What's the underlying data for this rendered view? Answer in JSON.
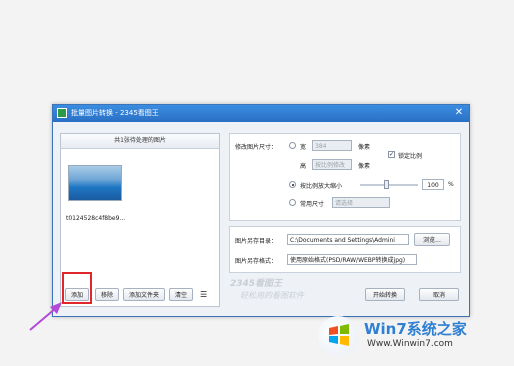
{
  "window": {
    "title": "批量图片转换 - 2345看图王",
    "close": "✕"
  },
  "left_panel": {
    "header": "共1张待处理的图片",
    "thumb_label": "t0124528c4f8be9..."
  },
  "bottom_buttons": {
    "add": "添加",
    "remove": "移除",
    "add_folder": "添加文件夹",
    "clear": "清空",
    "list_icon": "☰"
  },
  "resize": {
    "label": "修改图片尺寸：",
    "width_label": "宽",
    "width_value": "384",
    "width_unit": "像素",
    "height_label": "高",
    "height_value": "按比例修改",
    "height_unit": "像素",
    "keep_ratio": "锁定比例",
    "scale_label": "按比例放大缩小",
    "scale_value": "100",
    "scale_unit": "%",
    "common_label": "常用尺寸",
    "common_value": "请选择",
    "scale_slider_percent": 45
  },
  "output": {
    "dir_label": "图片另存目录：",
    "dir_value": "C:\\Documents and Settings\\Admini",
    "browse": "浏览...",
    "format_label": "图片另存格式：",
    "format_value": "使用原始格式(PSD/RAW/WEBP转换成jpg)"
  },
  "watermark": {
    "brand": "2345看图王",
    "slogan": "轻松用的看图软件"
  },
  "actions": {
    "start": "开始转换",
    "cancel": "取消"
  },
  "site_logo": {
    "name": "Win7系统之家",
    "url": "Www.Winwin7.com"
  },
  "colors": {
    "highlight": "#e0262a",
    "arrow": "#b14ad6",
    "titlebar": "#2a70c5"
  }
}
